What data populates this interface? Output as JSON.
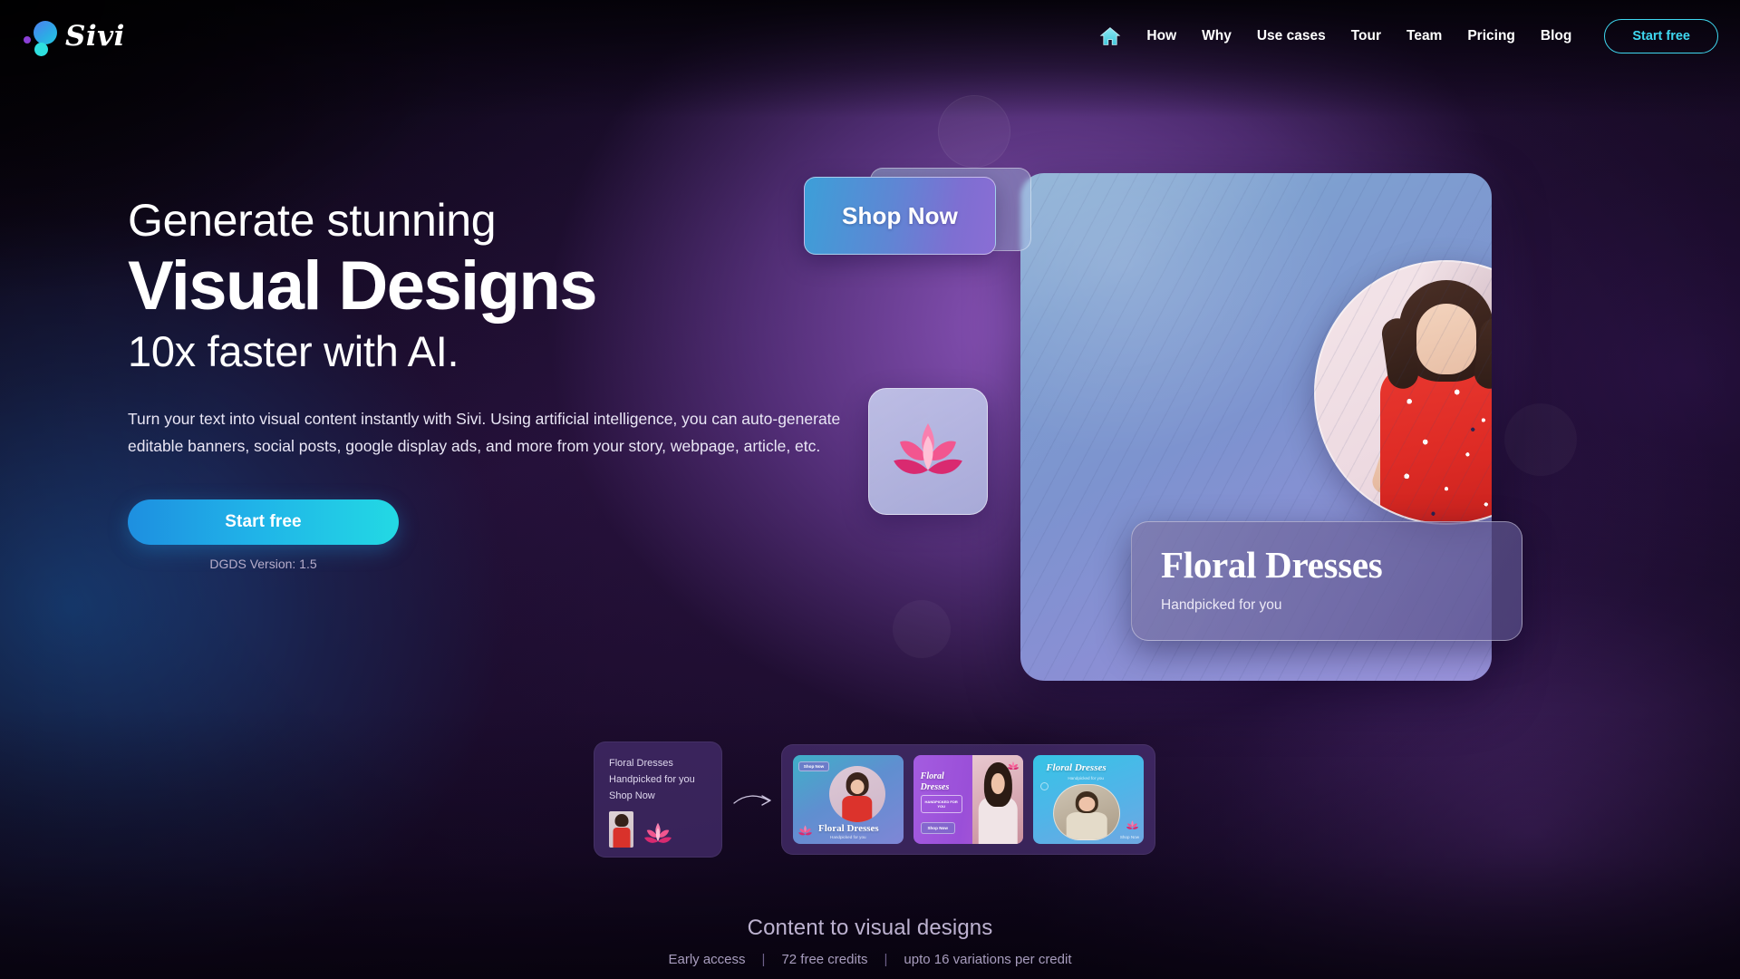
{
  "brand": {
    "name": "Sivi",
    "logo_icon": "sivi-dots-logo"
  },
  "nav": {
    "home_icon": "home-icon",
    "links": [
      {
        "label": "How"
      },
      {
        "label": "Why"
      },
      {
        "label": "Use cases"
      },
      {
        "label": "Tour"
      },
      {
        "label": "Team"
      },
      {
        "label": "Pricing"
      },
      {
        "label": "Blog"
      }
    ],
    "cta_label": "Start free",
    "cta_color": "#3fd8f0"
  },
  "hero": {
    "headline_line1": "Generate stunning",
    "headline_line2": "Visual Designs",
    "headline_line3": "10x faster with AI.",
    "paragraph": "Turn your text into visual content instantly with Sivi. Using artificial intelligence, you can auto-generate editable banners, social posts, google display ads, and more from your story, webpage, article, etc.",
    "cta_label": "Start free",
    "cta_gradient_from": "#1e8fe0",
    "cta_gradient_to": "#23d9e4",
    "version_note": "DGDS Version: 1.5"
  },
  "artwork": {
    "shop_now_label": "Shop Now",
    "lotus_icon": "lotus-flower-icon",
    "floral_title": "Floral Dresses",
    "floral_subtitle": "Handpicked for you",
    "model_image_alt": "woman-in-red-floral-dress"
  },
  "flow": {
    "input_lines": [
      "Floral Dresses",
      "Handpicked for you",
      "Shop Now"
    ],
    "input_thumb_alt": "floral-dress-thumbnail",
    "input_lotus_icon": "lotus-flower-icon",
    "arrow_icon": "curved-arrow-right-icon",
    "variants": [
      {
        "title": "Floral Dresses",
        "subtitle": "Handpicked for you",
        "chip": "Shop Now",
        "lotus_icon": "lotus-flower-icon"
      },
      {
        "title": "Floral Dresses",
        "subtitle": "HANDPICKED FOR YOU",
        "chip": "Shop Now",
        "lotus_icon": "lotus-flower-icon"
      },
      {
        "title": "Floral Dresses",
        "subtitle": "Handpicked for you",
        "chip": "Shop Now",
        "lotus_icon": "lotus-flower-icon"
      }
    ]
  },
  "footer": {
    "tagline": "Content to visual designs",
    "facts": [
      "Early access",
      "72 free credits",
      "upto 16 variations per credit"
    ],
    "divider": "|"
  }
}
